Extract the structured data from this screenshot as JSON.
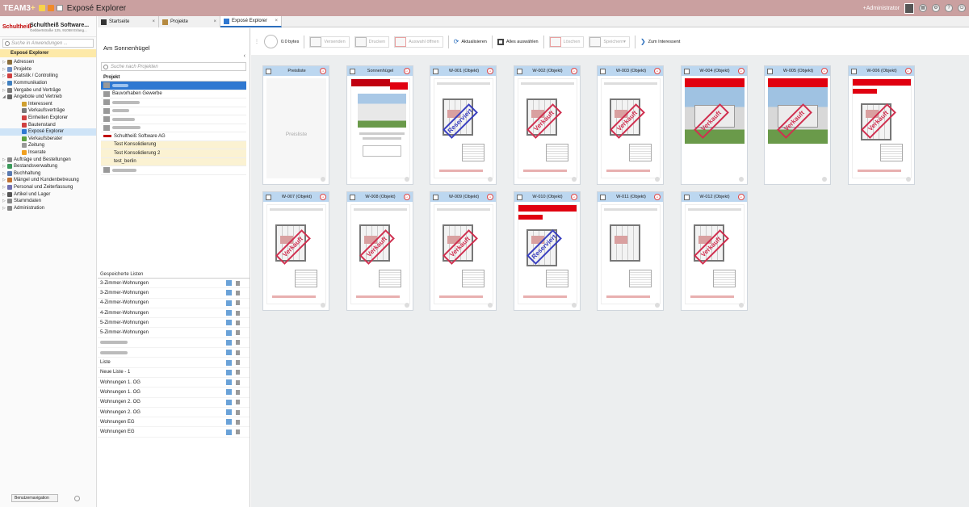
{
  "titlebar": {
    "logo": "TEAM3",
    "logo_plus": "+",
    "app_title": "Exposé Explorer",
    "user": "+Administrator",
    "colors": {
      "bar": "#caa0a0"
    }
  },
  "company": {
    "logo": "Schultheiß",
    "name": "Schultheiß Software...",
    "address": "Gebbertstraße 125, 91058 Erlang..."
  },
  "sidebar": {
    "search_placeholder": "Suche in Anwendungen ...",
    "active": "Exposé Explorer",
    "items": [
      {
        "label": "Adressen",
        "icon": "address-book-icon",
        "indent": 0,
        "expand": "▷"
      },
      {
        "label": "Projekte",
        "icon": "projects-icon",
        "indent": 0,
        "expand": "▷"
      },
      {
        "label": "Statistik / Controlling",
        "icon": "pie-chart-icon",
        "indent": 0,
        "expand": "▷"
      },
      {
        "label": "Kommunikation",
        "icon": "monitor-icon",
        "indent": 0,
        "expand": "▷"
      },
      {
        "label": "Vergabe und Verträge",
        "icon": "contract-icon",
        "indent": 0,
        "expand": "▷"
      },
      {
        "label": "Angebote und Vertrieb",
        "icon": "sales-icon",
        "indent": 0,
        "expand": "◢"
      },
      {
        "label": "Interessent",
        "icon": "person-icon",
        "indent": 1,
        "expand": ""
      },
      {
        "label": "Verkaufsverträge",
        "icon": "contract-icon",
        "indent": 1,
        "expand": ""
      },
      {
        "label": "Einheiten Explorer",
        "icon": "house-icon",
        "indent": 1,
        "expand": ""
      },
      {
        "label": "Bautenstand",
        "icon": "calendar-icon",
        "indent": 1,
        "expand": ""
      },
      {
        "label": "Exposé Explorer",
        "icon": "expose-icon",
        "indent": 1,
        "expand": "",
        "selected": true
      },
      {
        "label": "Verkaufsberater",
        "icon": "advisor-icon",
        "indent": 1,
        "expand": ""
      },
      {
        "label": "Zeitung",
        "icon": "newspaper-icon",
        "indent": 1,
        "expand": ""
      },
      {
        "label": "Inserate",
        "icon": "ad-icon",
        "indent": 1,
        "expand": ""
      },
      {
        "label": "Aufträge und Bestellungen",
        "icon": "order-icon",
        "indent": 0,
        "expand": "▷"
      },
      {
        "label": "Bestandsverwaltung",
        "icon": "inventory-icon",
        "indent": 0,
        "expand": "▷"
      },
      {
        "label": "Buchhaltung",
        "icon": "accounting-icon",
        "indent": 0,
        "expand": "▷"
      },
      {
        "label": "Mängel und Kundenbetreuung",
        "icon": "defect-icon",
        "indent": 0,
        "expand": "▷"
      },
      {
        "label": "Personal und Zeiterfassung",
        "icon": "staff-icon",
        "indent": 0,
        "expand": "▷"
      },
      {
        "label": "Artikel und Lager",
        "icon": "warehouse-icon",
        "indent": 0,
        "expand": "▷"
      },
      {
        "label": "Stammdaten",
        "icon": "master-data-icon",
        "indent": 0,
        "expand": "▷"
      },
      {
        "label": "Administration",
        "icon": "admin-icon",
        "indent": 0,
        "expand": "▷"
      }
    ],
    "user_nav": "Benutzernavigation"
  },
  "tabs": [
    {
      "label": "Startseite",
      "icon": "home-icon"
    },
    {
      "label": "Projekte",
      "icon": "projects-icon"
    },
    {
      "label": "Exposé Explorer",
      "icon": "expose-icon",
      "active": true
    }
  ],
  "project_panel": {
    "title": "Am Sonnenhügel",
    "search_placeholder": "Suche nach Projekten",
    "column_header": "Projekt",
    "rows": [
      {
        "label": "",
        "selected": true,
        "blurred": true
      },
      {
        "label": "Bauvorhaben Gewerbe"
      },
      {
        "label": "",
        "blurred": true
      },
      {
        "label": "",
        "blurred": true
      },
      {
        "label": "",
        "blurred": true
      },
      {
        "label": "",
        "blurred": true
      },
      {
        "label": "Schultheiß Software AG"
      },
      {
        "label": "Test Konsolidierung",
        "yellow": true
      },
      {
        "label": "Test Konsolidierung 2",
        "yellow": true
      },
      {
        "label": "test_berlin",
        "yellow": true
      },
      {
        "label": "",
        "blurred": true
      }
    ],
    "saved_lists_title": "Gespeicherte Listen",
    "saved_lists": [
      "3-Zimmer-Wohnungen",
      "3-Zimmer-Wohnungen",
      "4-Zimmer-Wohnungen",
      "4-Zimmer-Wohnungen",
      "5-Zimmer-Wohnungen",
      "5-Zimmer-Wohnungen",
      "",
      "",
      "Liste",
      "Neue Liste - 1",
      "Wohnungen 1. OG",
      "Wohnungen 1. OG",
      "Wohnungen 2. OG",
      "Wohnungen 2. OG",
      "Wohnungen EG",
      "Wohnungen EG"
    ]
  },
  "toolbar": {
    "size": "0.0 bytes",
    "buttons": [
      {
        "label": "Versenden",
        "disabled": true
      },
      {
        "label": "Drucken",
        "disabled": true
      },
      {
        "label": "Auswahl öffnen",
        "disabled": true
      },
      {
        "label": "Aktualisieren",
        "disabled": false
      },
      {
        "label": "Alles auswählen",
        "disabled": false
      },
      {
        "label": "Löschen",
        "disabled": true
      },
      {
        "label": "Speichern",
        "disabled": true
      },
      {
        "label": "Zum Interessent",
        "disabled": false
      }
    ]
  },
  "cards": [
    {
      "name": "Preisliste",
      "kind": "price"
    },
    {
      "name": "Sonnenhügel",
      "kind": "cover"
    },
    {
      "name": "W-001 (Objekt)",
      "kind": "plan",
      "stamp": "Reserviert"
    },
    {
      "name": "W-002 (Objekt)",
      "kind": "plan",
      "stamp": "Verkauft"
    },
    {
      "name": "W-003 (Objekt)",
      "kind": "plan",
      "stamp": "Verkauft"
    },
    {
      "name": "W-004 (Objekt)",
      "kind": "photo",
      "stamp": "Verkauft"
    },
    {
      "name": "W-005 (Objekt)",
      "kind": "photo",
      "stamp": "Verkauft"
    },
    {
      "name": "W-006 (Objekt)",
      "kind": "plan",
      "stamp": "Verkauft"
    },
    {
      "name": "W-007 (Objekt)",
      "kind": "plan",
      "stamp": "Verkauft"
    },
    {
      "name": "W-008 (Objekt)",
      "kind": "plan",
      "stamp": "Verkauft"
    },
    {
      "name": "W-009 (Objekt)",
      "kind": "plan",
      "stamp": "Verkauft"
    },
    {
      "name": "W-010 (Objekt)",
      "kind": "plan",
      "stamp": "Reserviert"
    },
    {
      "name": "W-011 (Objekt)",
      "kind": "plan",
      "stamp": ""
    },
    {
      "name": "W-012 (Objekt)",
      "kind": "plan",
      "stamp": "Verkauft"
    }
  ],
  "price_card_label": "Preisliste"
}
